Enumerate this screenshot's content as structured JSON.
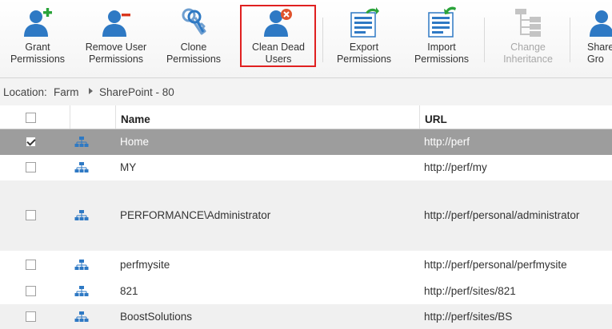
{
  "ribbon": {
    "buttons": [
      {
        "label": "Grant\nPermissions",
        "icon": "grant-permissions-icon"
      },
      {
        "label": "Remove User\nPermissions",
        "icon": "remove-user-permissions-icon"
      },
      {
        "label": "Clone\nPermissions",
        "icon": "clone-permissions-icon"
      },
      {
        "label": "Clean Dead\nUsers",
        "icon": "clean-dead-users-icon",
        "selected": true
      },
      {
        "label": "Export\nPermissions",
        "icon": "export-permissions-icon"
      },
      {
        "label": "Import\nPermissions",
        "icon": "import-permissions-icon"
      },
      {
        "label": "Change\nInheritance",
        "icon": "change-inheritance-icon",
        "disabled": true
      },
      {
        "label": "Share\nGro",
        "icon": "sharepoint-groups-icon"
      }
    ]
  },
  "location": {
    "label": "Location:",
    "path": [
      "Farm",
      "SharePoint - 80"
    ]
  },
  "grid": {
    "columns": [
      "Name",
      "URL"
    ],
    "rows": [
      {
        "name": "Home",
        "url": "http://perf",
        "checked": true
      },
      {
        "name": "MY",
        "url": "http://perf/my",
        "checked": false
      },
      {
        "name": "PERFORMANCE\\Administrator",
        "url": "http://perf/personal/administrator",
        "checked": false
      },
      {
        "name": "perfmysite",
        "url": "http://perf/personal/perfmysite",
        "checked": false
      },
      {
        "name": "821",
        "url": "http://perf/sites/821",
        "checked": false
      },
      {
        "name": "BoostSolutions",
        "url": "http://perf/sites/BS",
        "checked": false
      }
    ]
  },
  "colors": {
    "accent_blue": "#2e79c4",
    "selection_border": "#e02020",
    "selected_row": "#9d9d9d",
    "add_green": "#2aa33a",
    "remove_red": "#d9381e"
  }
}
